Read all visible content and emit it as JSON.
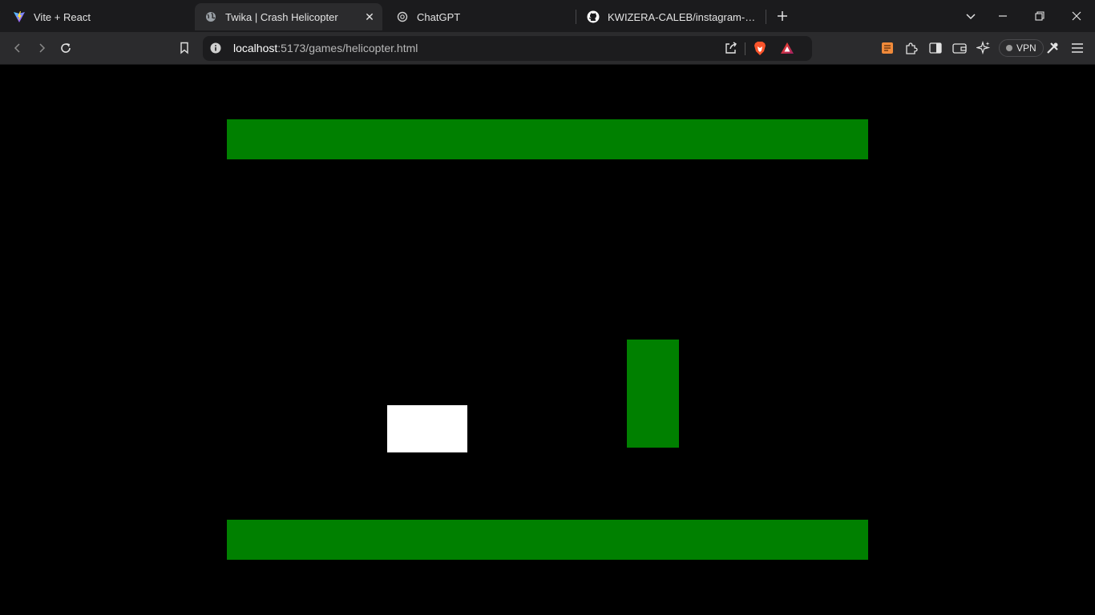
{
  "tabs": [
    {
      "title": "Vite + React",
      "icon": "vite-icon",
      "active": false
    },
    {
      "title": "Twika | Crash Helicopter",
      "icon": "globe-icon",
      "active": true
    },
    {
      "title": "ChatGPT",
      "icon": "chatgpt-icon",
      "active": false
    },
    {
      "title": "KWIZERA-CALEB/instagram-clone: T",
      "icon": "github-icon",
      "active": false
    }
  ],
  "address_bar": {
    "host": "localhost",
    "path": ":5173/games/helicopter.html"
  },
  "vpn": {
    "label": "VPN"
  },
  "colors": {
    "obstacle": "#008000",
    "helicopter": "#ffffff",
    "background": "#000000"
  },
  "game": {
    "title": "Twika | Crash Helicopter",
    "objects": [
      "top-wall",
      "bottom-wall",
      "obstacle",
      "helicopter"
    ]
  }
}
